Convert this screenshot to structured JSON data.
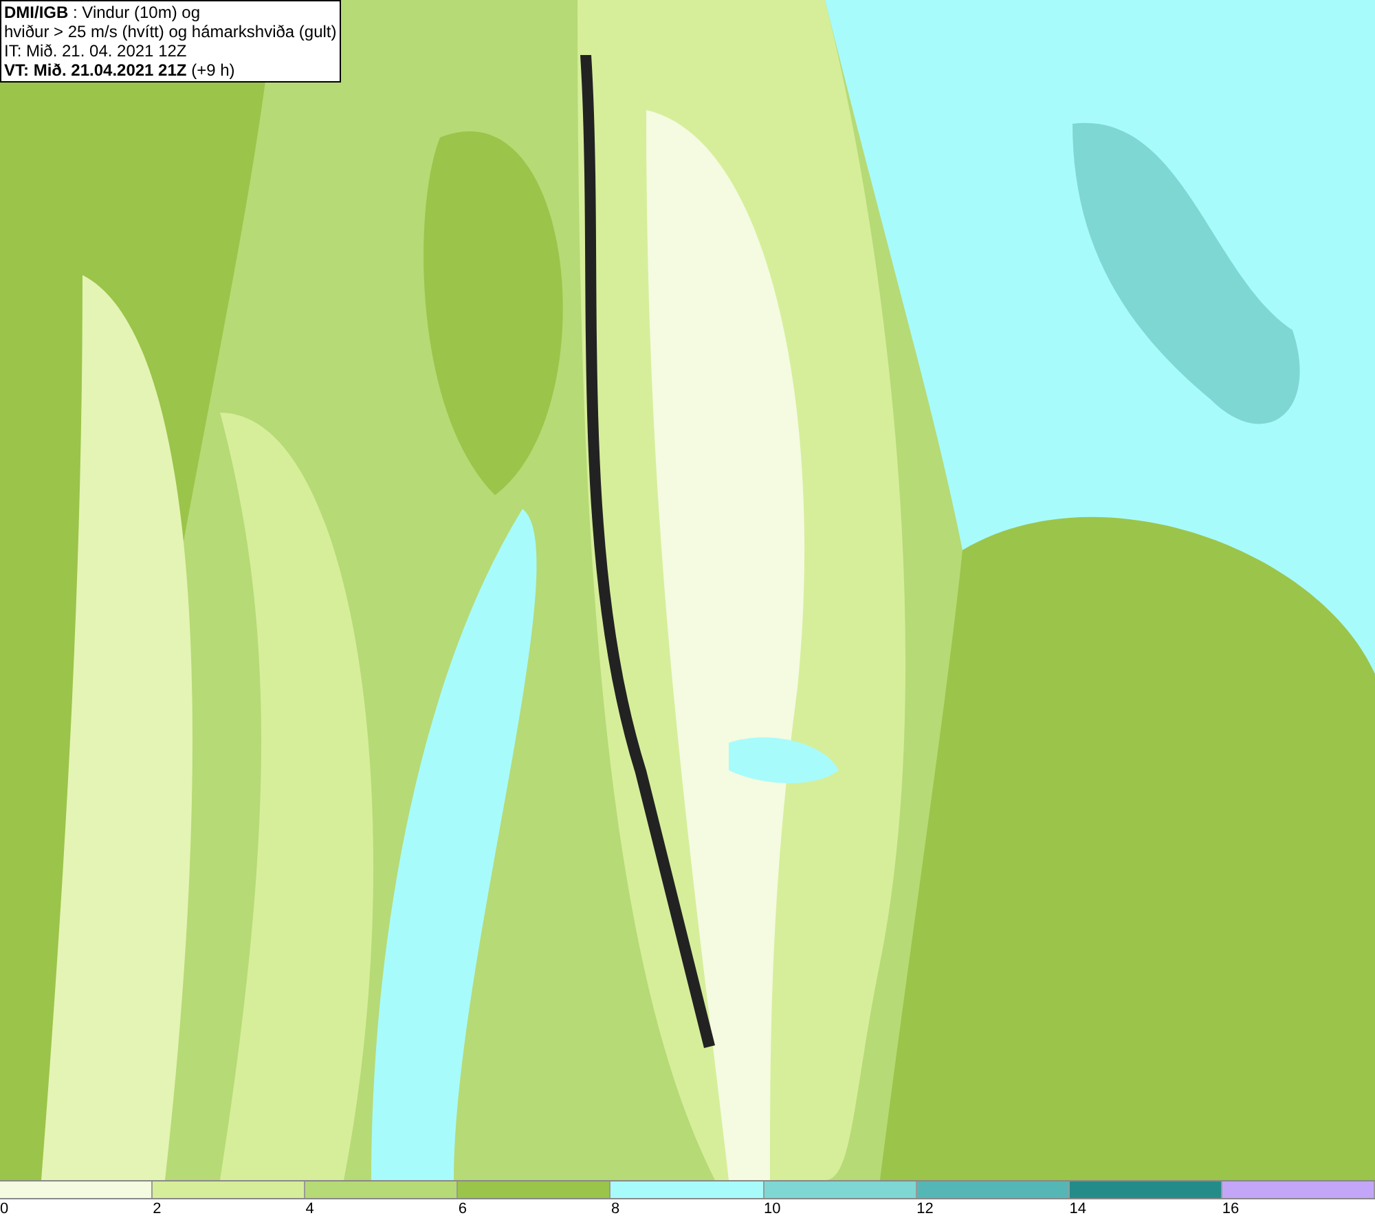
{
  "header": {
    "lines": [
      "**DMI/IGB** : Vindur (10m) og",
      "hviður > 25 m/s (hvítt) og hámarkshviða (gult)",
      "IT: Mið. 21. 04. 2021 12Z",
      "**VT: Mið. 21.04.2021 21Z** (+9 h)"
    ]
  },
  "legend": {
    "segments": [
      {
        "color": "#f4fbe0"
      },
      {
        "color": "#d6ee9a"
      },
      {
        "color": "#b6da75"
      },
      {
        "color": "#9bc44a"
      },
      {
        "color": "#a8fbfb"
      },
      {
        "color": "#7fd7d3"
      },
      {
        "color": "#55b7b5"
      },
      {
        "color": "#238c89"
      },
      {
        "color": "#c3a6f7"
      }
    ],
    "labels": [
      "0",
      "2",
      "4",
      "6",
      "8",
      "10",
      "12",
      "14",
      "16"
    ]
  }
}
